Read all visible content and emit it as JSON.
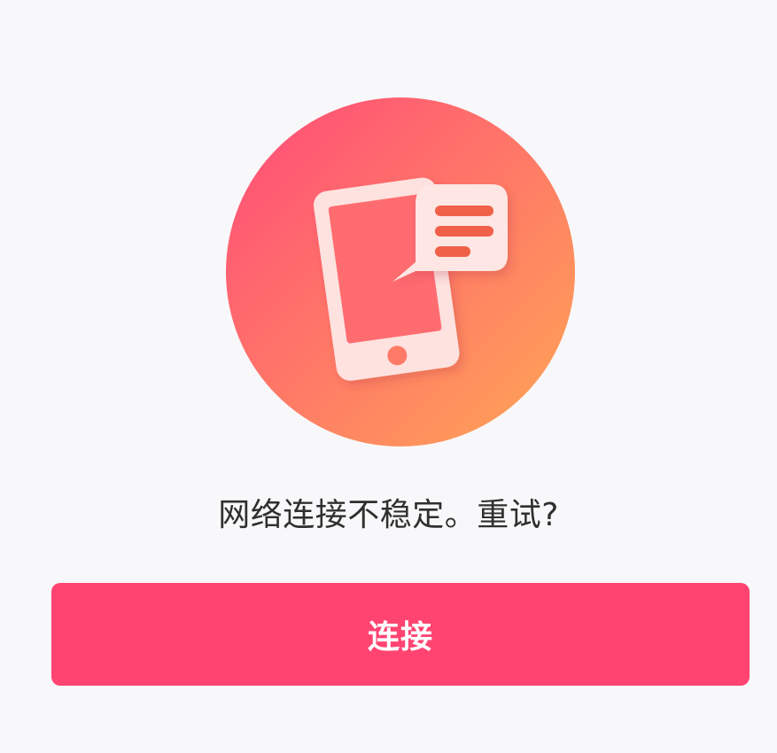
{
  "illustration": {
    "icon": "phone-message-icon",
    "gradient_start": "#ff4f78",
    "gradient_end": "#ffa356"
  },
  "status": {
    "message": "网络连接不稳定。重试?"
  },
  "actions": {
    "connect_label": "连接",
    "button_color": "#ff4472"
  }
}
